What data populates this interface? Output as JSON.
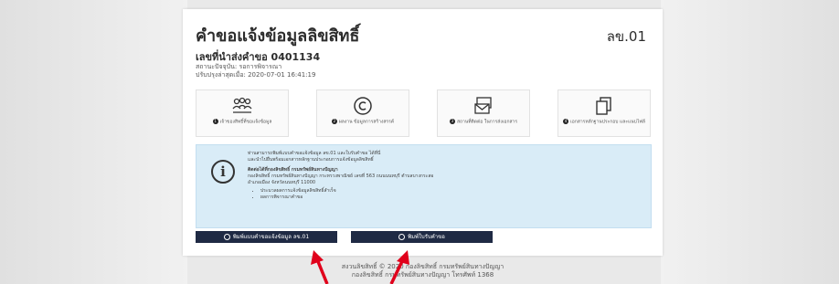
{
  "form": {
    "title": "คำขอแจ้งข้อมูลลิขสิทธิ์",
    "code": "ลข.01",
    "request_number": "เลขที่นำส่งคำขอ 0401134",
    "status": "สถานะปัจจุบัน: รอการพิจารณา",
    "updated": "ปรับปรุงล่าสุดเมื่อ: 2020-07-01 16:41:19"
  },
  "steps": [
    {
      "num": "1",
      "label": "เจ้าของสิทธิ์ที่ขอแจ้งข้อมูล",
      "icon": "people-icon"
    },
    {
      "num": "2",
      "label": "ผลงาน ข้อมูลการสร้างสรรค์",
      "icon": "copyright-icon"
    },
    {
      "num": "3",
      "label": "สถานที่ติดต่อ ในการส่งเอกสาร",
      "icon": "mail-icon"
    },
    {
      "num": "4",
      "label": "เอกสารหลักฐานประกอบ และแนบไฟล์",
      "icon": "documents-icon"
    }
  ],
  "info": {
    "line1": "ท่านสามารถพิมพ์แบบคำขอแจ้งข้อมูล ลข.01 และใบรับคำขอ ได้ที่นี่",
    "line2": "และนำไปยื่นพร้อมเอกสารหลักฐานประกอบการแจ้งข้อมูลลิขสิทธิ์",
    "line3": "ติดต่อได้ที่กองลิขสิทธิ์ กรมทรัพย์สินทางปัญญา",
    "line4": "กองลิขสิทธิ์ กรมทรัพย์สินทางปัญญา กระทรวงพาณิชย์ เลขที่ 563 ถนนนนทบุรี ตำบลบางกระสอ",
    "line5": "อำเภอเมือง จังหวัดนนทบุรี 11000",
    "bullets": [
      "ประมวลผลการแจ้งข้อมูลลิขสิทธิ์สำเร็จ",
      "ผลการพิจารณาคำขอ"
    ]
  },
  "buttons": {
    "print_form": "พิมพ์แบบคำขอแจ้งข้อมูล ลข.01",
    "print_receipt": "พิมพ์ใบรับคำขอ"
  },
  "footer": {
    "line1": "สงวนลิขสิทธิ์ © 2020 กองลิขสิทธิ์ กรมทรัพย์สินทางปัญญา",
    "line2": "กองลิขสิทธิ์ กรมทรัพย์สินทางปัญญา โทรศัพท์ 1368"
  },
  "colors": {
    "accent": "#1f2a44",
    "info_bg": "#d9ecf7",
    "arrow": "#e0001b"
  }
}
